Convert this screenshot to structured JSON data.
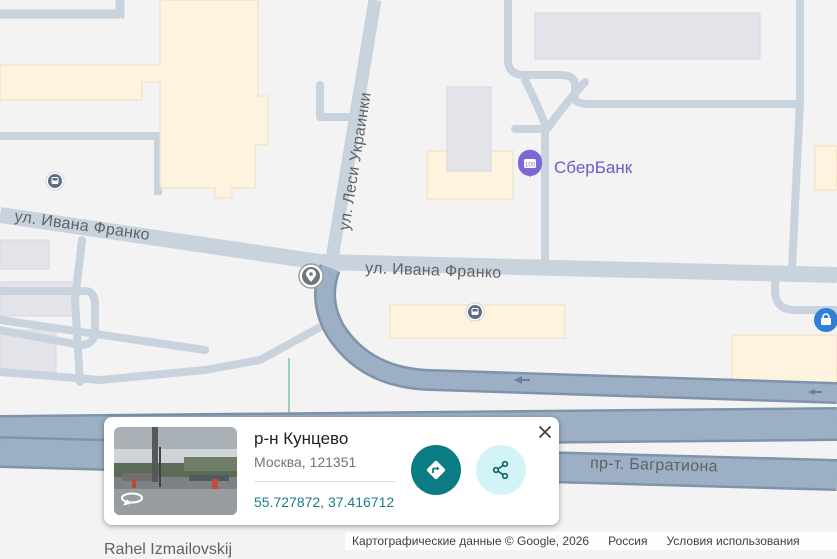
{
  "map": {
    "streets": {
      "ivana_franko_left": "ул. Ивана Франко",
      "ivana_franko_right": "ул. Ивана Франко",
      "lesi_ukrainki": "ул. Леси Украинки",
      "bagrationa": "пр-т. Багратиона"
    },
    "pois": {
      "sberbank": "СберБанк"
    },
    "partial_bottom_label": "Rahel Izmailovskij"
  },
  "card": {
    "title": "р-н Кунцево",
    "address": "Москва, 121351",
    "coordinates": "55.727872, 37.416712"
  },
  "footer": {
    "map_data": "Картографические данные © Google, 2026",
    "region": "Россия",
    "terms": "Условия использования"
  },
  "colors": {
    "background": "#f3f3f4",
    "road": "#c9d3dd",
    "highway": "#8fa2b9",
    "building": "#fdf3de",
    "directions_button": "#0b7b84",
    "share_button": "#d3f4f7",
    "coords_link": "#1a7f87",
    "poi_text": "#6a5cc7"
  }
}
